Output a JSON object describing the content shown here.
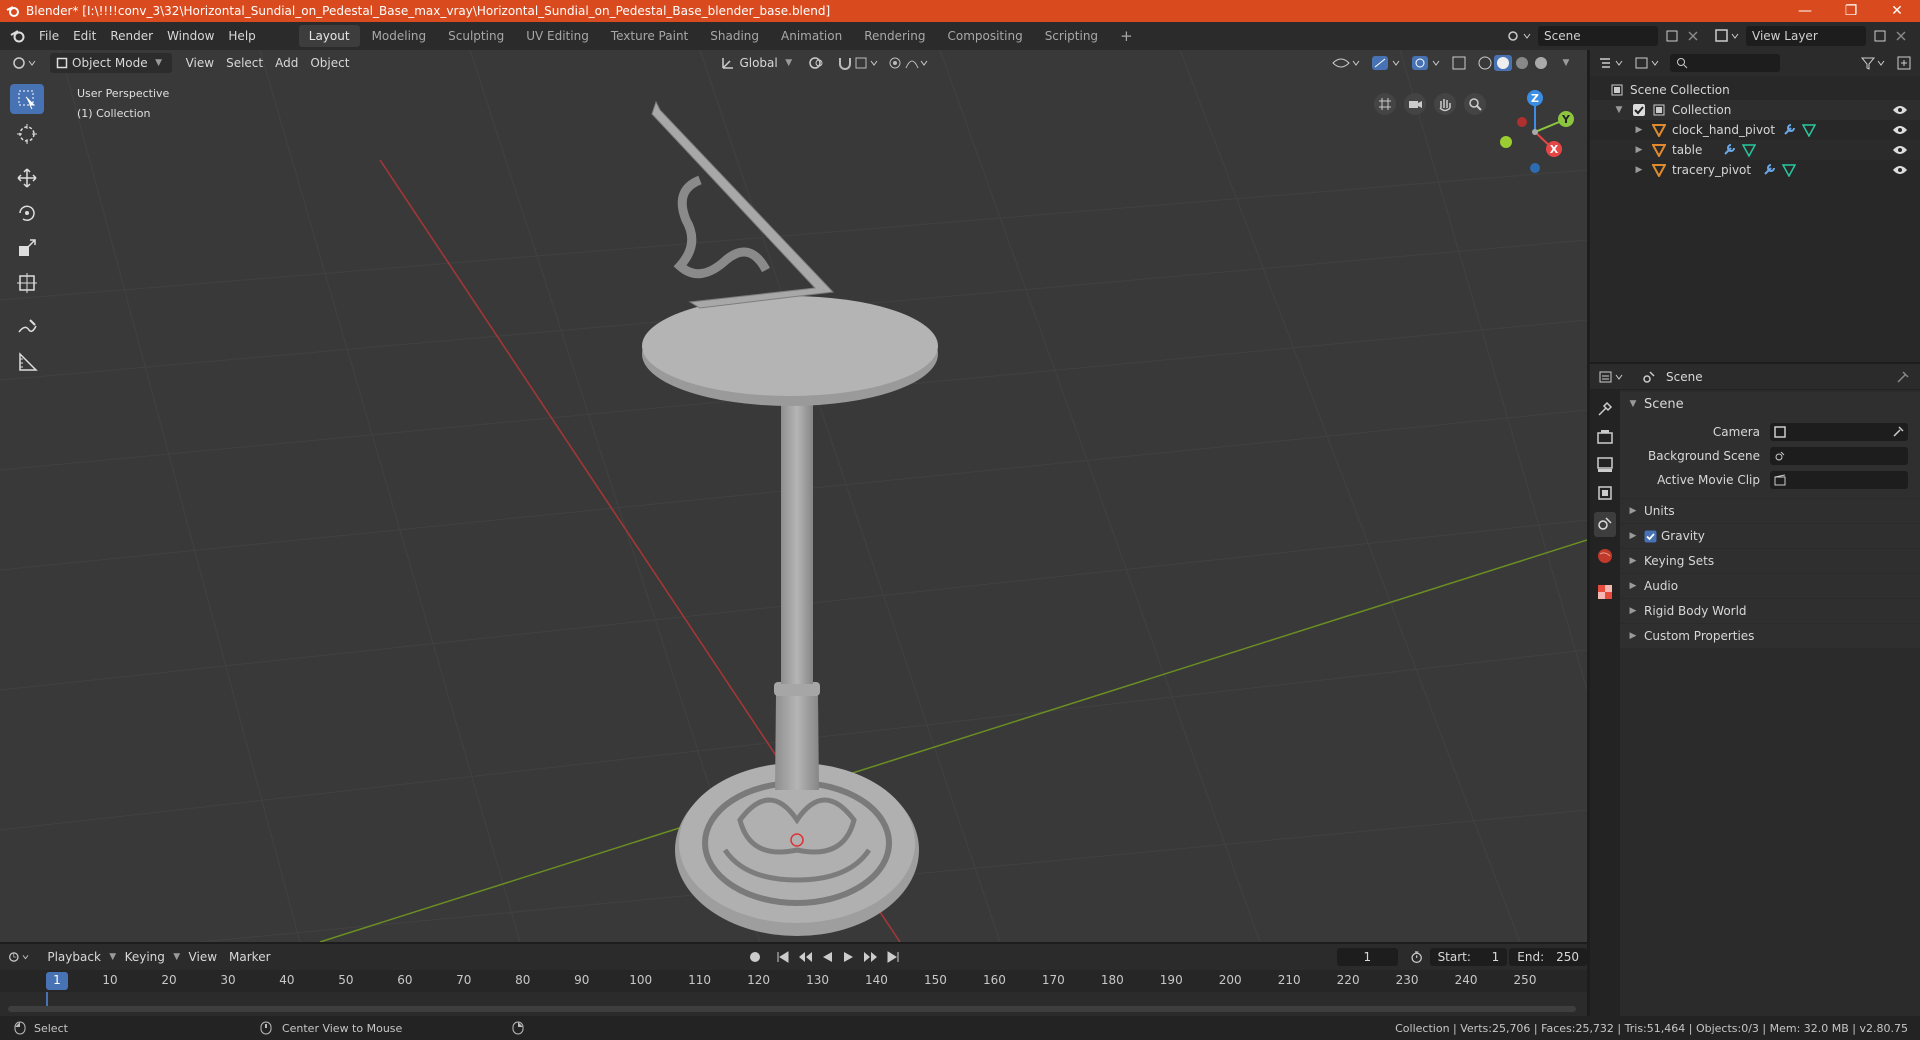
{
  "window": {
    "title": "Blender* [I:\\!!!!conv_3\\32\\Horizontal_Sundial_on_Pedestal_Base_max_vray\\Horizontal_Sundial_on_Pedestal_Base_blender_base.blend]",
    "controls": [
      "—",
      "❐",
      "✕"
    ]
  },
  "menu": [
    "File",
    "Edit",
    "Render",
    "Window",
    "Help"
  ],
  "workspaces": [
    "Layout",
    "Modeling",
    "Sculpting",
    "UV Editing",
    "Texture Paint",
    "Shading",
    "Animation",
    "Rendering",
    "Compositing",
    "Scripting"
  ],
  "workspace_add": "+",
  "scene_field": "Scene",
  "viewlayer_field": "View Layer",
  "viewport": {
    "mode": "Object Mode",
    "menus": [
      "View",
      "Select",
      "Add",
      "Object"
    ],
    "orientation": "Global",
    "overlay_line1": "User Perspective",
    "overlay_line2": "(1) Collection",
    "gizmo_axes": {
      "z": "Z",
      "y": "Y",
      "x": "X"
    }
  },
  "outliner": {
    "root": "Scene Collection",
    "collection": "Collection",
    "objects": [
      "clock_hand_pivot",
      "table",
      "tracery_pivot"
    ]
  },
  "properties": {
    "context": "Scene",
    "panel": "Scene",
    "fields": [
      {
        "label": "Camera",
        "value": ""
      },
      {
        "label": "Background Scene",
        "value": ""
      },
      {
        "label": "Active Movie Clip",
        "value": ""
      }
    ],
    "sections": [
      {
        "label": "Units",
        "checkbox": false
      },
      {
        "label": "Gravity",
        "checkbox": true
      },
      {
        "label": "Keying Sets",
        "checkbox": false
      },
      {
        "label": "Audio",
        "checkbox": false
      },
      {
        "label": "Rigid Body World",
        "checkbox": false
      },
      {
        "label": "Custom Properties",
        "checkbox": false
      }
    ]
  },
  "timeline": {
    "menus": [
      "Playback",
      "Keying",
      "View",
      "Marker"
    ],
    "current_frame": "1",
    "start_label": "Start:",
    "start": "1",
    "end_label": "End:",
    "end": "250",
    "ticks": [
      "1",
      "10",
      "20",
      "30",
      "40",
      "50",
      "60",
      "70",
      "80",
      "90",
      "100",
      "110",
      "120",
      "130",
      "140",
      "150",
      "160",
      "170",
      "180",
      "190",
      "200",
      "210",
      "220",
      "230",
      "240",
      "250"
    ]
  },
  "status": {
    "left": "Select",
    "middle": "Center View to Mouse",
    "right": "Collection | Verts:25,706 | Faces:25,732 | Tris:51,464 | Objects:0/3 | Mem: 32.0 MB | v2.80.75"
  }
}
